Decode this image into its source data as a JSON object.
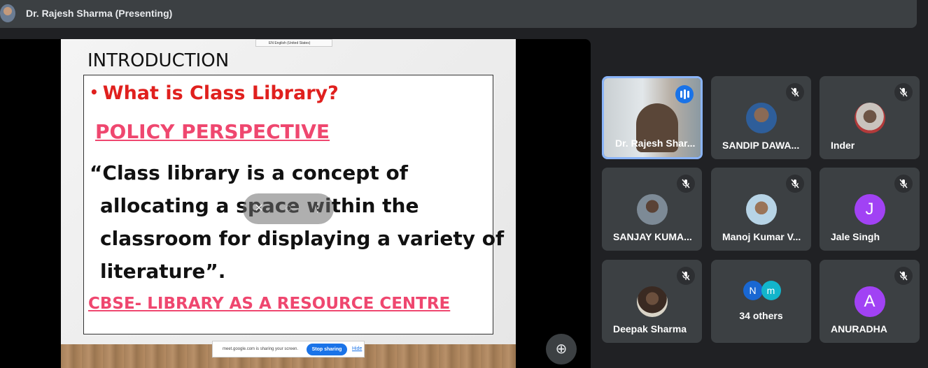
{
  "presenter": {
    "name": "Dr. Rajesh Sharma (Presenting)"
  },
  "slide": {
    "language_indicator": "EN English (United States)",
    "title": "INTRODUCTION",
    "bullet": "What is Class Library?",
    "policy_heading": "POLICY PERSPECTIVE",
    "quote_lines": [
      "“Class library is a concept of",
      "allocating a space within the",
      "classroom for displaying a variety of",
      "literature”."
    ],
    "footer_link": "CBSE- LIBRARY AS A RESOURCE CENTRE"
  },
  "share_bar": {
    "text": "meet.google.com is sharing your screen.",
    "stop_label": "Stop sharing",
    "hide_label": "Hide"
  },
  "participants": [
    {
      "name": "Dr. Rajesh Shar...",
      "type": "video",
      "speaking": true
    },
    {
      "name": "SANDIP DAWA...",
      "type": "photo",
      "muted": true
    },
    {
      "name": "Inder",
      "type": "photo",
      "muted": true
    },
    {
      "name": "SANJAY KUMA...",
      "type": "photo",
      "muted": true
    },
    {
      "name": "Manoj Kumar V...",
      "type": "photo",
      "muted": true
    },
    {
      "name": "Jale Singh",
      "type": "letter",
      "letter": "J",
      "color": "#a142f4",
      "muted": true
    },
    {
      "name": "Deepak Sharma",
      "type": "photo",
      "muted": true
    },
    {
      "name": "34 others",
      "type": "group",
      "letters": [
        "N",
        "m"
      ],
      "colors": [
        "#1967d2",
        "#12b5cb"
      ]
    },
    {
      "name": "ANURADHA",
      "type": "letter",
      "letter": "A",
      "color": "#a142f4",
      "muted": true
    }
  ],
  "colors": {
    "accent": "#8ab4f8",
    "slide_red": "#e0201e",
    "slide_pink": "#ef476f"
  }
}
